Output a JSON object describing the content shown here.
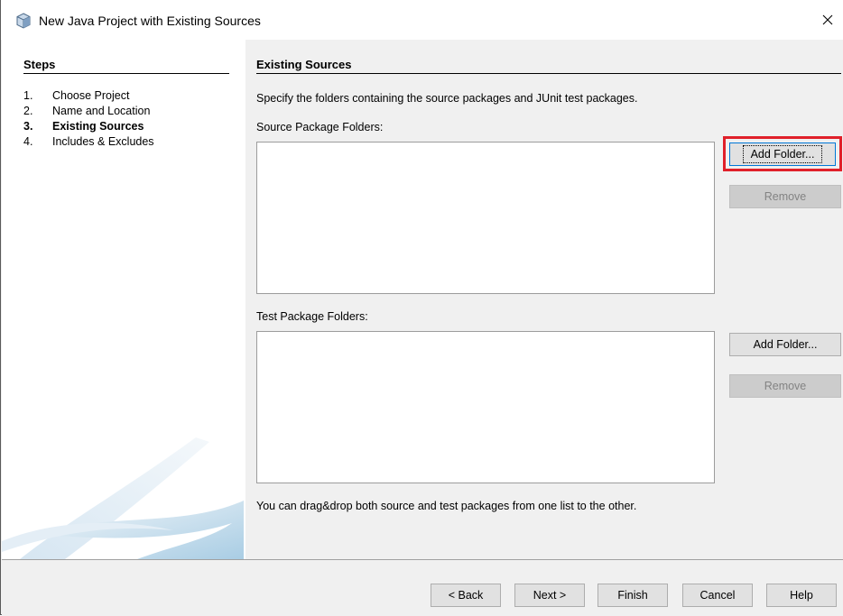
{
  "window": {
    "title": "New Java Project with Existing Sources"
  },
  "steps": {
    "header": "Steps",
    "items": [
      {
        "num": "1.",
        "label": "Choose Project"
      },
      {
        "num": "2.",
        "label": "Name and Location"
      },
      {
        "num": "3.",
        "label": "Existing Sources"
      },
      {
        "num": "4.",
        "label": "Includes & Excludes"
      }
    ],
    "current_index": 2
  },
  "main": {
    "title": "Existing Sources",
    "description": "Specify the folders containing the source packages and JUnit test packages.",
    "source_label": "Source Package Folders:",
    "test_label": "Test Package Folders:",
    "source_add": "Add Folder...",
    "source_remove": "Remove",
    "test_add": "Add Folder...",
    "test_remove": "Remove",
    "hint": "You can drag&drop both source and test packages from one list to the other."
  },
  "footer": {
    "back": "< Back",
    "next": "Next >",
    "finish": "Finish",
    "cancel": "Cancel",
    "help": "Help"
  },
  "colors": {
    "highlight": "#e0202a",
    "focus": "#0078d7"
  }
}
